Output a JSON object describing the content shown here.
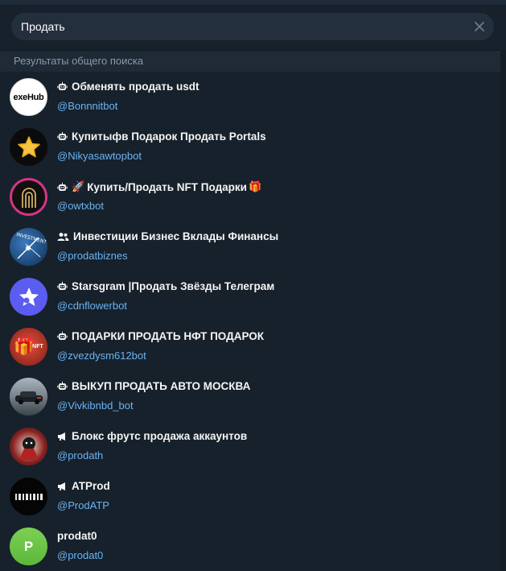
{
  "search": {
    "value": "Продать",
    "clear_label": "×"
  },
  "results": {
    "section_title": "Результаты общего поиска",
    "items": [
      {
        "type": "bot",
        "title": "Обменять продать usdt",
        "username": "@Bonnnitbot",
        "avatar_text": "exeHub",
        "avatar_color": "#ffffff"
      },
      {
        "type": "bot",
        "title": "Купитыфв Подарок Продать Portals",
        "username": "@Nikyasawtopbot",
        "avatar_text": "",
        "avatar_color": "#0b0b0b"
      },
      {
        "type": "bot",
        "title": "Купить/Продать NFT Подарки",
        "emoji_prefix": "🚀",
        "emoji_suffix": "🎁",
        "username": "@owtxbot",
        "avatar_text": "",
        "avatar_color": "#101010"
      },
      {
        "type": "group",
        "title": "Инвестиции Бизнес Вклады Финансы",
        "username": "@prodatbiznes",
        "avatar_text": "INVESTMENT",
        "avatar_color": "#1a4a7a"
      },
      {
        "type": "bot",
        "title": "Starsgram |Продать Звёзды Телеграм",
        "username": "@cdnflowerbot",
        "avatar_text": "",
        "avatar_color": "#5b5cf0"
      },
      {
        "type": "bot",
        "title": "ПОДАРКИ ПРОДАТЬ НФТ ПОДАРОК",
        "username": "@zvezdysm612bot",
        "avatar_text": "NFT",
        "avatar_color": "#c0392b"
      },
      {
        "type": "bot",
        "title": "ВЫКУП ПРОДАТЬ АВТО МОСКВА",
        "username": "@Vivkibnbd_bot",
        "avatar_text": "",
        "avatar_color": "#5a6470"
      },
      {
        "type": "channel",
        "title": "Блокс фрутс продажа аккаунтов",
        "username": "@prodath",
        "avatar_text": "",
        "avatar_color": "#2a2a2a"
      },
      {
        "type": "channel",
        "title": "ATProd",
        "username": "@ProdATP",
        "avatar_text": "",
        "avatar_color": "#050505"
      },
      {
        "type": "user",
        "title": "prodat0",
        "username": "@prodat0",
        "avatar_text": "P",
        "avatar_color": "#6cc04a"
      }
    ]
  }
}
